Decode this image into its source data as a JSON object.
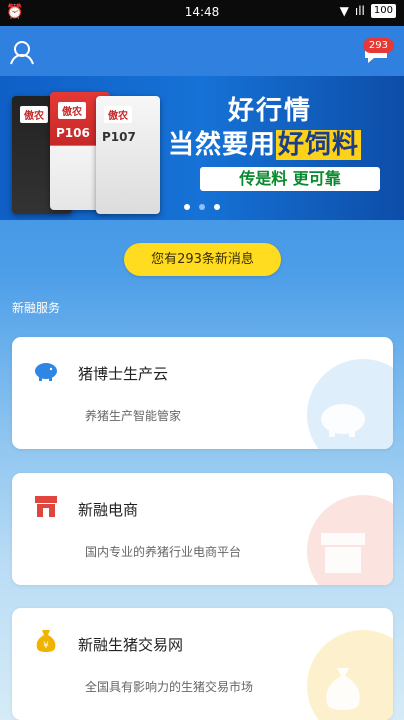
{
  "status": {
    "time": "14:48",
    "battery": "100"
  },
  "header": {
    "badge": "293"
  },
  "banner": {
    "bags": [
      {
        "brand": "傲农",
        "code": ""
      },
      {
        "brand": "傲农",
        "code": "P106"
      },
      {
        "brand": "傲农",
        "code": "P107"
      }
    ],
    "line1": "好行情",
    "line2_prefix": "当然要用",
    "line2_highlight": "好饲料",
    "line3": "传是料 更可靠"
  },
  "notice": "您有293条新消息",
  "section_title": "新融服务",
  "cards": [
    {
      "title": "猪博士生产云",
      "desc": "养猪生产智能管家",
      "icon": "piggy-bank-icon",
      "color": "#2f86e3",
      "circle": "#dfeefb"
    },
    {
      "title": "新融电商",
      "desc": "国内专业的养猪行业电商平台",
      "icon": "shop-icon",
      "color": "#e0463d",
      "circle": "#fbe3e0"
    },
    {
      "title": "新融生猪交易网",
      "desc": "全国具有影响力的生猪交易市场",
      "icon": "money-bag-icon",
      "color": "#f0b400",
      "circle": "#fcf1cc"
    }
  ]
}
